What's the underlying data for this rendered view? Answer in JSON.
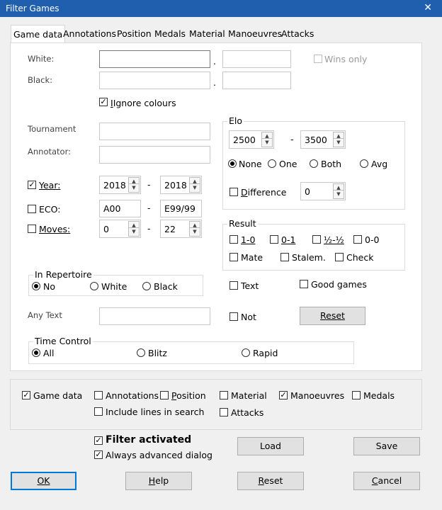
{
  "window": {
    "title": "Filter Games",
    "close_glyph": "✕"
  },
  "tabs": [
    "Game data",
    "Annotations",
    "Position",
    "Medals",
    "Material",
    "Manoeuvres",
    "Attacks"
  ],
  "players": {
    "white_label": "White:",
    "black_label": "Black:",
    "dot": ".",
    "wins_only": "Wins only",
    "ignore_colours": "Ignore colours"
  },
  "fields": {
    "tournament_label": "Tournament",
    "annotator_label": "Annotator:"
  },
  "year": {
    "label": "Year:",
    "from": "2018",
    "to": "2018"
  },
  "eco": {
    "label": "ECO:",
    "from": "A00",
    "to": "E99/99"
  },
  "moves": {
    "label": "Moves:",
    "from": "0",
    "to": "22"
  },
  "dash": "-",
  "elo": {
    "title": "Elo",
    "from": "2500",
    "to": "3500",
    "options": [
      "None",
      "One",
      "Both",
      "Avg"
    ],
    "difference_label": "Difference",
    "difference_value": "0"
  },
  "result": {
    "title": "Result",
    "items": [
      "1-0",
      "0-1",
      "½-½",
      "0-0",
      "Mate",
      "Stalem.",
      "Check"
    ]
  },
  "repertoire": {
    "title": "In Repertoire",
    "options": [
      "No",
      "White",
      "Black"
    ]
  },
  "text_cb": "Text",
  "good_games": "Good games",
  "any_text_label": "Any Text",
  "not_cb": "Not",
  "reset_inner": "Reset",
  "time_control": {
    "title": "Time Control",
    "options": [
      "All",
      "Blitz",
      "Rapid"
    ]
  },
  "bottom": {
    "game_data": "Game data",
    "annotations": "Annotations",
    "position": "Position",
    "material": "Material",
    "manoeuvres": "Manoeuvres",
    "medals": "Medals",
    "include_lines": "Include lines in search",
    "attacks": "Attacks"
  },
  "filter_activated": "Filter activated",
  "always_advanced": "Always advanced dialog",
  "buttons": {
    "load": "Load",
    "save": "Save",
    "ok": "OK",
    "help": "Help",
    "reset": "Reset",
    "cancel": "Cancel"
  },
  "check_glyph": "✓"
}
